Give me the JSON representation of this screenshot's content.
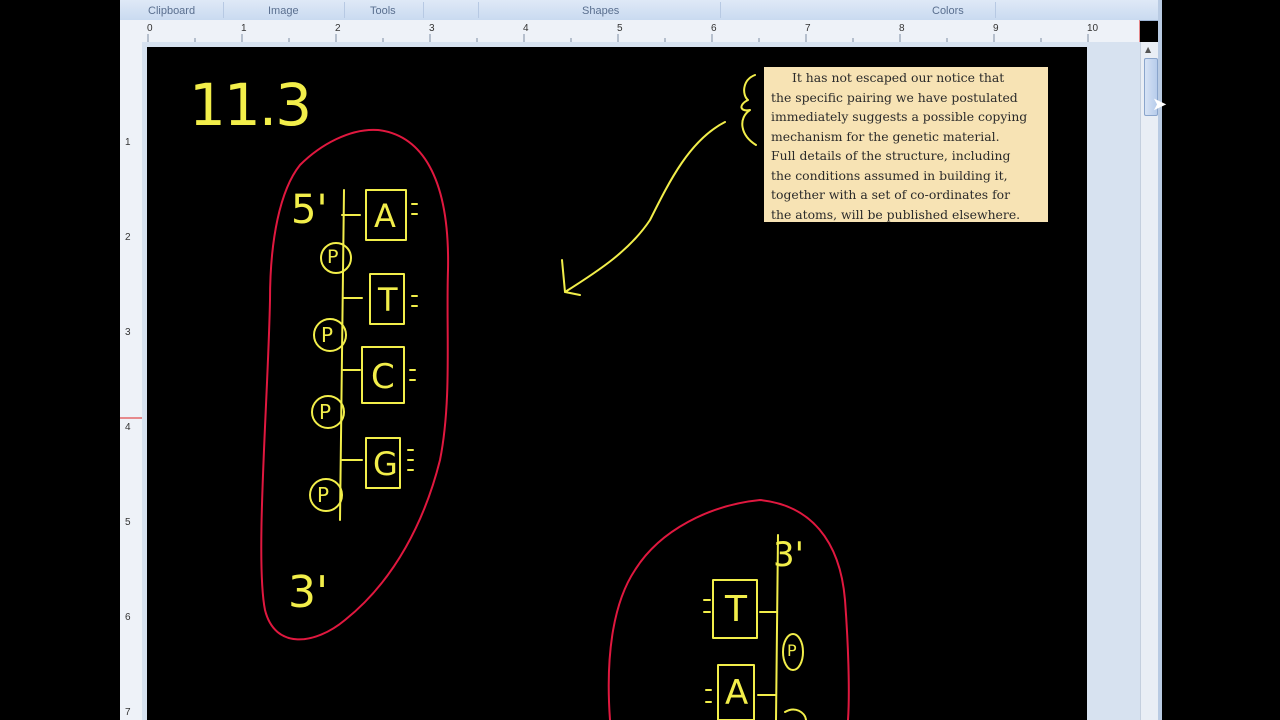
{
  "ribbon": {
    "groups": [
      "Clipboard",
      "Image",
      "Tools",
      "Shapes",
      "Colors"
    ]
  },
  "ruler": {
    "horizontal_ticks": [
      "0",
      "1",
      "2",
      "3",
      "4",
      "5",
      "6",
      "7",
      "8",
      "9",
      "10"
    ],
    "vertical_ticks": [
      "1",
      "2",
      "3",
      "4",
      "5",
      "6",
      "7"
    ]
  },
  "drawing": {
    "heading": "11.3",
    "strand1": {
      "end_top": "5'",
      "end_bottom": "3'",
      "bases": [
        "A",
        "T",
        "C",
        "G"
      ],
      "phosphate": "P"
    },
    "strand2": {
      "end_top": "3'",
      "bases": [
        "T",
        "A"
      ],
      "phosphate": "P"
    }
  },
  "quote": {
    "lines": [
      "It has not escaped our notice that",
      "the specific pairing we have postulated",
      "immediately suggests a possible copying",
      "mechanism for the genetic material.",
      "Full details of the structure, including",
      "the conditions assumed in building it,",
      "together with a set of co-ordinates for",
      "the atoms, will be published elsewhere."
    ]
  },
  "colors": {
    "ink_yellow": "#f2ee4a",
    "ink_red": "#e0183f",
    "quote_bg": "#f7e3b4",
    "canvas": "#000000"
  }
}
